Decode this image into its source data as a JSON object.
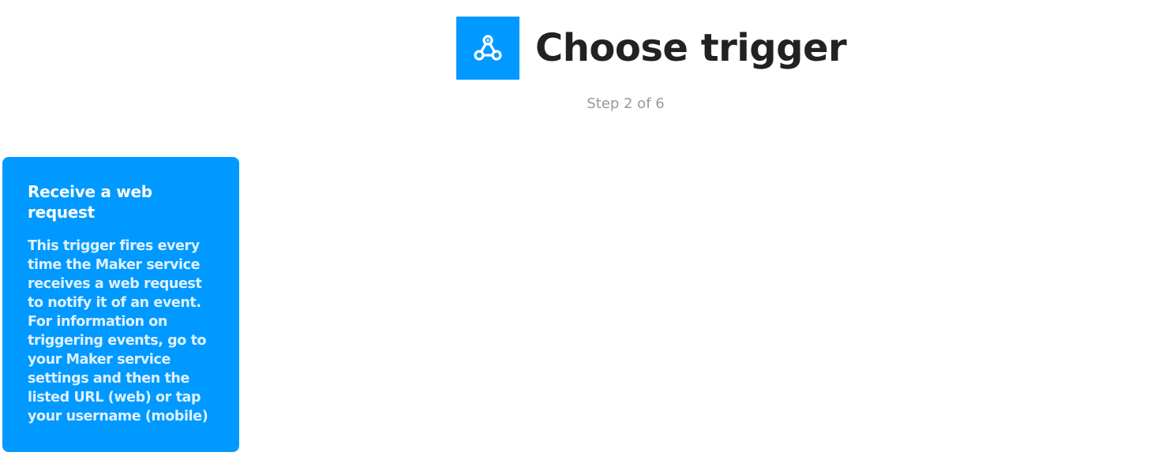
{
  "header": {
    "service_icon": "webhooks-icon",
    "title": "Choose trigger",
    "step": "Step 2 of 6"
  },
  "triggers": [
    {
      "title": "Receive a web request",
      "description": "This trigger fires every time the Maker service receives a web request to notify it of an event. For information on triggering events, go to your Maker service settings and then the listed URL (web) or tap your username (mobile)"
    }
  ],
  "colors": {
    "brand": "#0099ff",
    "title_text": "#222222",
    "step_text": "#999999",
    "card_text": "#ffffff"
  }
}
